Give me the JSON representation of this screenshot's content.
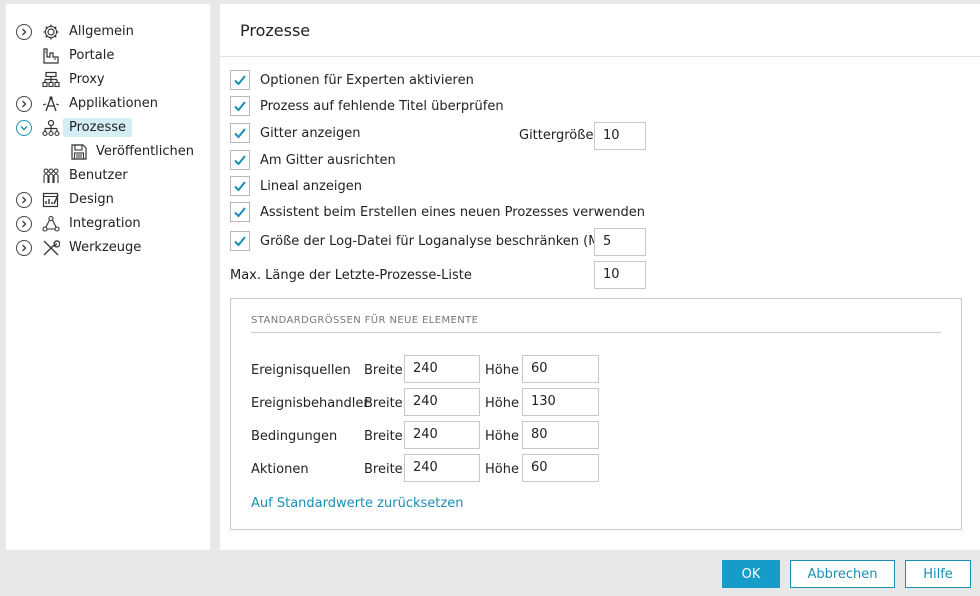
{
  "sidebar": {
    "items": [
      {
        "label": "Allgemein",
        "icon": "gear-icon",
        "expandable": true
      },
      {
        "label": "Portale",
        "icon": "portal-icon",
        "expandable": false
      },
      {
        "label": "Proxy",
        "icon": "proxy-icon",
        "expandable": false
      },
      {
        "label": "Applikationen",
        "icon": "applications-icon",
        "expandable": true
      },
      {
        "label": "Prozesse",
        "icon": "process-icon",
        "expandable": true,
        "selected": true
      },
      {
        "label": "Veröffentlichen",
        "icon": "save-icon",
        "expandable": false
      },
      {
        "label": "Benutzer",
        "icon": "users-icon",
        "expandable": false
      },
      {
        "label": "Design",
        "icon": "design-icon",
        "expandable": true
      },
      {
        "label": "Integration",
        "icon": "integration-icon",
        "expandable": true
      },
      {
        "label": "Werkzeuge",
        "icon": "tools-icon",
        "expandable": true
      }
    ]
  },
  "main": {
    "title": "Prozesse",
    "checkboxes": [
      {
        "label": "Optionen für Experten aktivieren",
        "checked": true
      },
      {
        "label": "Prozess auf fehlende Titel überprüfen",
        "checked": true
      },
      {
        "label": "Gitter anzeigen",
        "checked": true
      },
      {
        "label": "Am Gitter ausrichten",
        "checked": true
      },
      {
        "label": "Lineal anzeigen",
        "checked": true
      },
      {
        "label": "Assistent beim Erstellen eines neuen Prozesses verwenden",
        "checked": true
      },
      {
        "label": "Größe der Log-Datei für Loganalyse beschränken (MB)",
        "checked": true
      }
    ],
    "grid_size_label": "Gittergröße",
    "grid_size_value": "10",
    "log_size_value": "5",
    "recent_list_label": "Max. Länge der Letzte-Prozesse-Liste",
    "recent_list_value": "10"
  },
  "defaults": {
    "title": "STANDARDGRÖSSEN FÜR NEUE ELEMENTE",
    "width_label": "Breite",
    "height_label": "Höhe",
    "rows": [
      {
        "name": "Ereignisquellen",
        "width": "240",
        "height": "60"
      },
      {
        "name": "Ereignisbehandler",
        "width": "240",
        "height": "130"
      },
      {
        "name": "Bedingungen",
        "width": "240",
        "height": "80"
      },
      {
        "name": "Aktionen",
        "width": "240",
        "height": "60"
      }
    ],
    "reset_link": "Auf Standardwerte zurücksetzen"
  },
  "footer": {
    "ok": "OK",
    "cancel": "Abbrechen",
    "help": "Hilfe"
  },
  "colors": {
    "accent": "#169cc8",
    "selected_bg": "#d5edf5"
  }
}
